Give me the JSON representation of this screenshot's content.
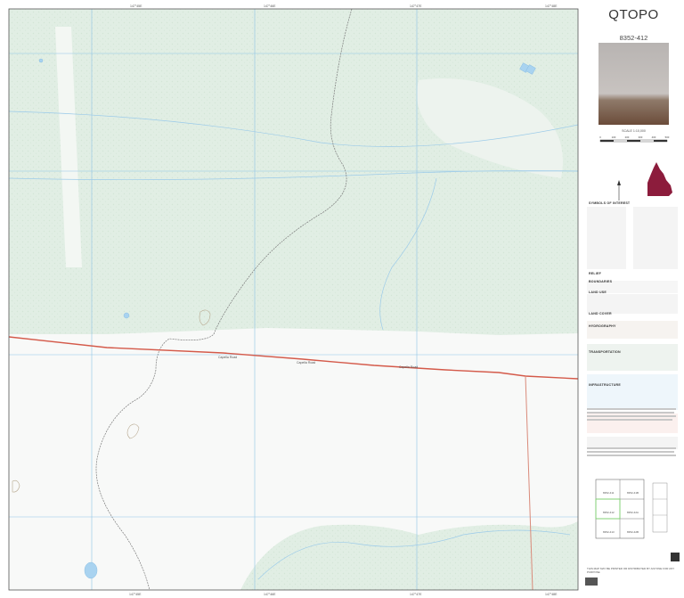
{
  "app_title": "QTOPO",
  "sheet_number": "8352-412",
  "scale_text": "SCALE 1:10,000",
  "scale_bar_ticks": [
    "0",
    "100",
    "200",
    "300",
    "400",
    "500"
  ],
  "legend_heading": "SYMBOLS OF INTEREST",
  "legend_sections": [
    "RELIEF",
    "BOUNDARIES",
    "LAND USE",
    "LAND COVER",
    "HYDROGRAPHY",
    "TRANSPORTATION",
    "INFRASTRUCTURE"
  ],
  "map_sheets": [
    [
      "8352-411",
      "8352-41B"
    ],
    [
      "8352-412",
      "8352-42A"
    ],
    [
      "8352-413",
      "8352-42B"
    ]
  ],
  "grid_labels_top": [
    "147°45E",
    "147°46E",
    "147°47E",
    "147°48E"
  ],
  "road_labels": [
    "Capella Road",
    "Capella Road",
    "Capella Road"
  ],
  "disclaimer_heading": "THIS MAP MAY BE PRINTED OR DISTRIBUTED BY ANYONE FOR ANY PURPOSE",
  "colors": {
    "forest": "#e1eee4",
    "cleared": "#f8f9f8",
    "grid": "#8fc3e6",
    "road": "#d45a4a",
    "track": "#777777",
    "water": "#a9d3f0",
    "contour": "#c9b89e",
    "region_highlight": "#8c1c3c"
  }
}
